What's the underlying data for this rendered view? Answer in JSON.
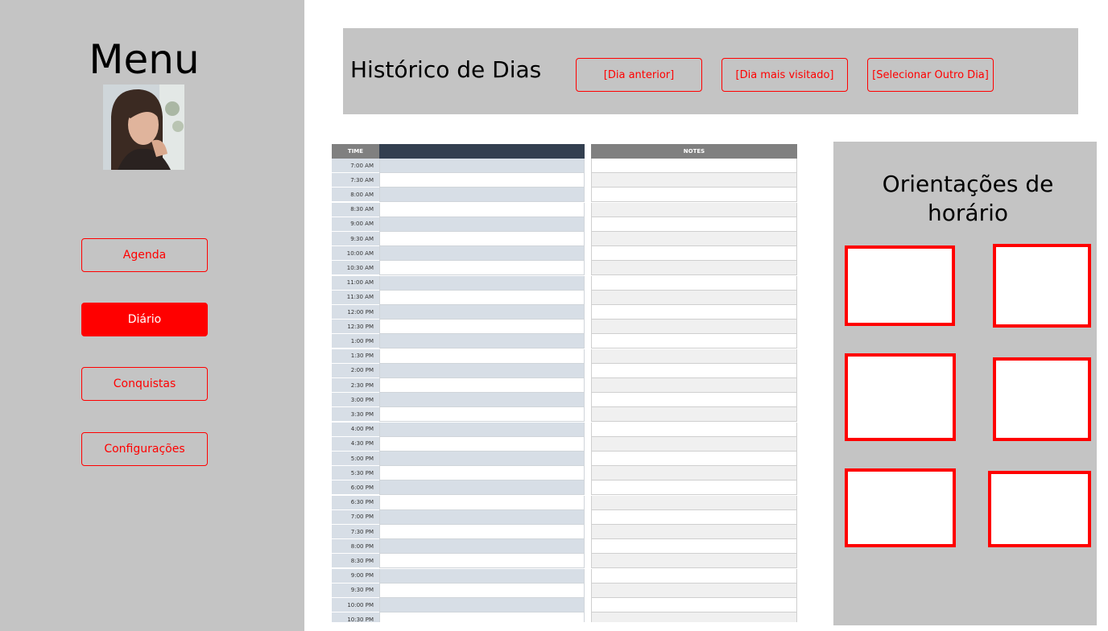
{
  "sidebar": {
    "title": "Menu",
    "nav": [
      {
        "label": "Agenda",
        "active": false
      },
      {
        "label": "Diário",
        "active": true
      },
      {
        "label": "Conquistas",
        "active": false
      },
      {
        "label": "Configurações",
        "active": false
      }
    ]
  },
  "header": {
    "title": "Histórico de Dias",
    "buttons": [
      "[Dia anterior]",
      "[Dia mais visitado]",
      "[Selecionar Outro Dia]"
    ]
  },
  "schedule": {
    "time_header": "TIME",
    "notes_header": "NOTES",
    "times": [
      "7:00 AM",
      "7:30 AM",
      "8:00 AM",
      "8:30 AM",
      "9:00 AM",
      "9:30 AM",
      "10:00 AM",
      "10:30 AM",
      "11:00 AM",
      "11:30 AM",
      "12:00 PM",
      "12:30 PM",
      "1:00 PM",
      "1:30 PM",
      "2:00 PM",
      "2:30 PM",
      "3:00 PM",
      "3:30 PM",
      "4:00 PM",
      "4:30 PM",
      "5:00 PM",
      "5:30 PM",
      "6:00 PM",
      "6:30 PM",
      "7:00 PM",
      "7:30 PM",
      "8:00 PM",
      "8:30 PM",
      "9:00 PM",
      "9:30 PM",
      "10:00 PM",
      "10:30 PM"
    ]
  },
  "orientation": {
    "title_line1": "Orientações de",
    "title_line2": "horário"
  },
  "colors": {
    "accent": "#ff0000",
    "panel": "#c4c4c4",
    "schedule_header_dark": "#333f50",
    "schedule_header_gray": "#808080",
    "time_col": "#d7dee6",
    "row_shade": "#d7dee6",
    "note_shade": "#f0f0f0"
  }
}
